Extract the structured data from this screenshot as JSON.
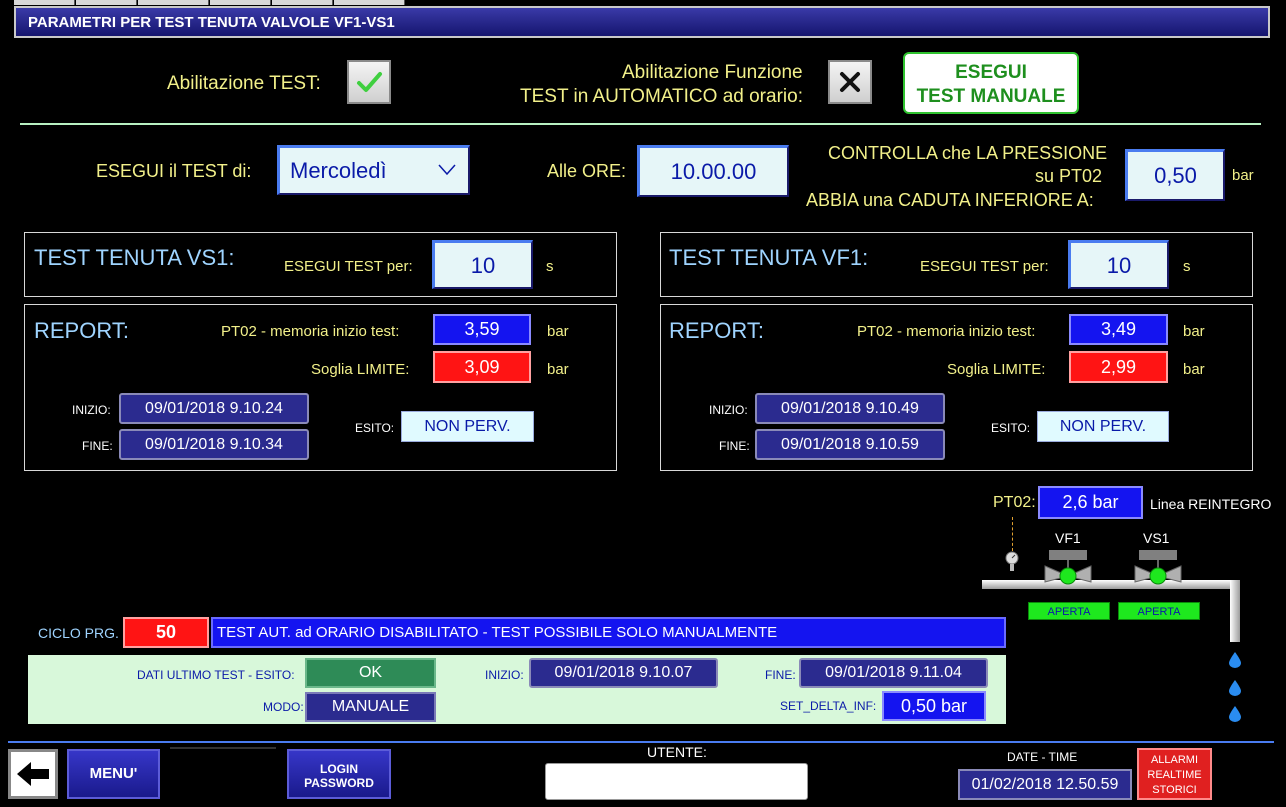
{
  "window": {
    "title": "PARAMETRI PER TEST TENUTA VALVOLE VF1-VS1"
  },
  "header": {
    "abilitazione_test_label": "Abilitazione TEST:",
    "abilitazione_test_checked": true,
    "abilitazione_auto_label_1": "Abilitazione Funzione",
    "abilitazione_auto_label_2": "TEST in AUTOMATICO ad orario:",
    "abilitazione_auto_checked": false,
    "esegui_manuale_line1": "ESEGUI",
    "esegui_manuale_line2": "TEST MANUALE"
  },
  "schedule": {
    "day_label": "ESEGUI il TEST di:",
    "day_value": "Mercoledì",
    "time_label": "Alle ORE:",
    "time_value": "10.00.00",
    "pressure_label_1": "CONTROLLA che LA PRESSIONE",
    "pressure_label_2": "su PT02",
    "pressure_label_3": "ABBIA una CADUTA INFERIORE A:",
    "pressure_value": "0,50",
    "pressure_unit": "bar"
  },
  "vs1": {
    "title": "TEST TENUTA VS1:",
    "duration_label": "ESEGUI TEST per:",
    "duration_value": "10",
    "duration_unit": "s",
    "report_title": "REPORT:",
    "pt02_label": "PT02 - memoria inizio test:",
    "pt02_value": "3,59",
    "pt02_unit": "bar",
    "soglia_label": "Soglia LIMITE:",
    "soglia_value": "3,09",
    "soglia_unit": "bar",
    "inizio_label": "INIZIO:",
    "inizio_value": "09/01/2018 9.10.24",
    "fine_label": "FINE:",
    "fine_value": "09/01/2018 9.10.34",
    "esito_label": "ESITO:",
    "esito_value": "NON PERV."
  },
  "vf1": {
    "title": "TEST TENUTA VF1:",
    "duration_label": "ESEGUI TEST per:",
    "duration_value": "10",
    "duration_unit": "s",
    "report_title": "REPORT:",
    "pt02_label": "PT02 - memoria inizio test:",
    "pt02_value": "3,49",
    "pt02_unit": "bar",
    "soglia_label": "Soglia LIMITE:",
    "soglia_value": "2,99",
    "soglia_unit": "bar",
    "inizio_label": "INIZIO:",
    "inizio_value": "09/01/2018 9.10.49",
    "fine_label": "FINE:",
    "fine_value": "09/01/2018 9.10.59",
    "esito_label": "ESITO:",
    "esito_value": "NON PERV."
  },
  "diagram": {
    "pt02_label": "PT02:",
    "pt02_value": "2,6 bar",
    "line_label": "Linea REINTEGRO",
    "vf1_label": "VF1",
    "vs1_label": "VS1",
    "vf1_state": "APERTA",
    "vs1_state": "APERTA",
    "valve_color": "#1ee81e"
  },
  "cycle": {
    "label": "CICLO PRG.",
    "value": "50",
    "message": "TEST AUT. ad ORARIO DISABILITATO - TEST POSSIBILE SOLO MANUALMENTE"
  },
  "last_test": {
    "esito_label": "DATI ULTIMO TEST - ESITO:",
    "esito_value": "OK",
    "modo_label": "MODO:",
    "modo_value": "MANUALE",
    "inizio_label": "INIZIO:",
    "inizio_value": "09/01/2018 9.10.07",
    "fine_label": "FINE:",
    "fine_value": "09/01/2018 9.11.04",
    "delta_label": "SET_DELTA_INF:",
    "delta_value": "0,50 bar"
  },
  "footer": {
    "back_icon": "arrow-left-icon",
    "menu_label": "MENU'",
    "login_line1": "LOGIN",
    "login_line2": "PASSWORD",
    "user_label": "UTENTE:",
    "user_value": "",
    "datetime_label": "DATE - TIME",
    "datetime_value": "01/02/2018 12.50.59",
    "alarms_line1": "ALLARMI",
    "alarms_line2": "REALTIME",
    "alarms_line3": "STORICI"
  },
  "colors": {
    "accent_blue": "#1414f0",
    "alarm_red": "#ff1414",
    "ok_green": "#2e8b57",
    "label_yellow": "#f2f08a"
  }
}
